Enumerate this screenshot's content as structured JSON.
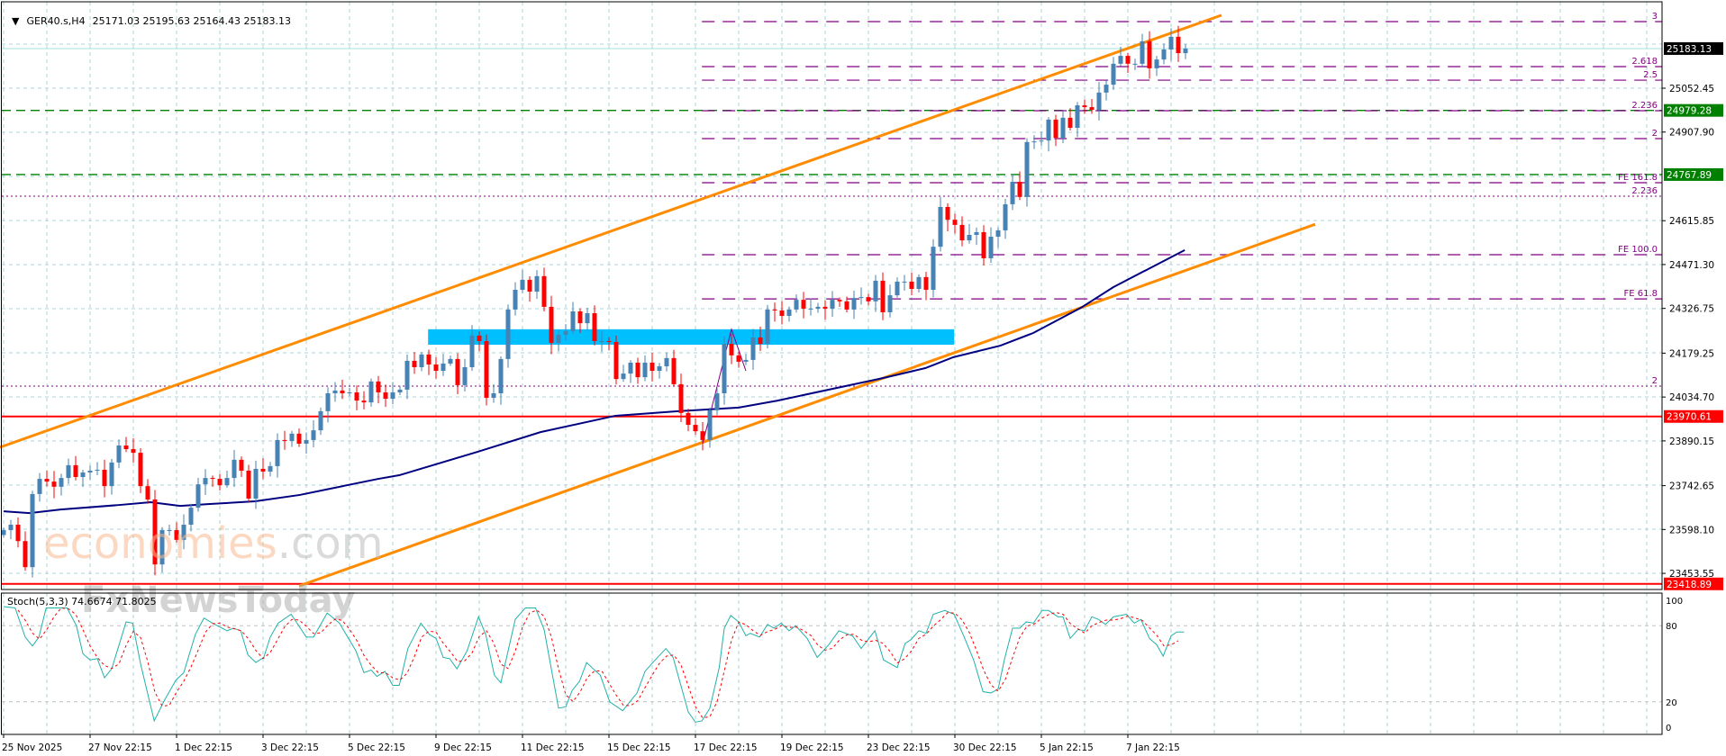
{
  "header": {
    "symbol": "GER40.s,H4",
    "ohlc": "25171.03 25195.63 25164.43 25183.13",
    "collapse_icon": "triangle-down-icon"
  },
  "colors": {
    "bull": "#4682b4",
    "bear": "#ff0000",
    "channel": "#ff8c00",
    "ma": "#000080",
    "zone": "#00bfff",
    "fib": "#800080",
    "support_green": "#008000",
    "support_red": "#ff0000",
    "grid": "#a8d4da",
    "stoch_k": "#20b2aa",
    "stoch_d": "#ff0000"
  },
  "watermark": {
    "brand1": "economies",
    "brand1_suffix": ".com",
    "brand2": "FxNewsToday"
  },
  "price_axis": {
    "ticks": [
      "25052.45",
      "24907.90",
      "24615.85",
      "24471.30",
      "24326.75",
      "24179.25",
      "24034.70",
      "23890.15",
      "23742.65",
      "23598.10",
      "23453.55"
    ],
    "markers": [
      {
        "value": "25183.13",
        "color": "#000000"
      },
      {
        "value": "24979.28",
        "color": "#008000"
      },
      {
        "value": "24767.89",
        "color": "#008000"
      },
      {
        "value": "23970.61",
        "color": "#ff0000"
      },
      {
        "value": "23418.89",
        "color": "#ff0000"
      }
    ]
  },
  "time_axis": {
    "labels": [
      {
        "i": 0,
        "text": "25 Nov 2025"
      },
      {
        "i": 12,
        "text": "27 Nov 22:15"
      },
      {
        "i": 24,
        "text": "1 Dec 22:15"
      },
      {
        "i": 36,
        "text": "3 Dec 22:15"
      },
      {
        "i": 48,
        "text": "5 Dec 22:15"
      },
      {
        "i": 60,
        "text": "9 Dec 22:15"
      },
      {
        "i": 72,
        "text": "11 Dec 22:15"
      },
      {
        "i": 84,
        "text": "15 Dec 22:15"
      },
      {
        "i": 96,
        "text": "17 Dec 22:15"
      },
      {
        "i": 108,
        "text": "19 Dec 22:15"
      },
      {
        "i": 120,
        "text": "23 Dec 22:15"
      },
      {
        "i": 132,
        "text": "30 Dec 22:15"
      },
      {
        "i": 144,
        "text": "5 Jan 22:15"
      },
      {
        "i": 156,
        "text": "7 Jan 22:15"
      }
    ]
  },
  "chart_data": {
    "type": "candlestick",
    "symbol": "GER40.s",
    "timeframe": "H4",
    "current_price": 25183.13,
    "closes": [
      23596,
      23614,
      23560,
      23474,
      23715,
      23765,
      23756,
      23739,
      23768,
      23810,
      23771,
      23786,
      23792,
      23795,
      23741,
      23819,
      23875,
      23863,
      23851,
      23741,
      23697,
      23483,
      23596,
      23596,
      23564,
      23614,
      23670,
      23747,
      23768,
      23765,
      23744,
      23768,
      23828,
      23792,
      23700,
      23798,
      23789,
      23807,
      23893,
      23890,
      23914,
      23881,
      23893,
      23925,
      23988,
      24047,
      24056,
      24047,
      24050,
      24023,
      24017,
      24086,
      24050,
      24029,
      24050,
      24059,
      24154,
      24133,
      24175,
      24142,
      24121,
      24145,
      24160,
      24074,
      24133,
      24237,
      24219,
      24032,
      24047,
      24160,
      24323,
      24388,
      24421,
      24382,
      24433,
      24332,
      24213,
      24240,
      24252,
      24317,
      24278,
      24311,
      24219,
      24219,
      24216,
      24094,
      24112,
      24148,
      24100,
      24148,
      24121,
      24136,
      24163,
      24077,
      23982,
      23943,
      23922,
      23893,
      23991,
      24047,
      24210,
      24172,
      24151,
      24157,
      24231,
      24210,
      24323,
      24320,
      24302,
      24323,
      24355,
      24326,
      24326,
      24332,
      24326,
      24355,
      24350,
      24323,
      24361,
      24364,
      24350,
      24418,
      24314,
      24370,
      24415,
      24415,
      24391,
      24430,
      24388,
      24530,
      24661,
      24619,
      24602,
      24551,
      24569,
      24578,
      24492,
      24563,
      24584,
      24670,
      24744,
      24694,
      24875,
      24877,
      24880,
      24949,
      24889,
      24955,
      24922,
      24996,
      24990,
      24981,
      25038,
      25064,
      25133,
      25159,
      25133,
      25133,
      25207,
      25118,
      25147,
      25180,
      25222,
      25168,
      25183
    ],
    "first_open": 23580,
    "moving_average": [
      [
        0,
        23658
      ],
      [
        3.6,
        23652
      ],
      [
        7.9,
        23664
      ],
      [
        16.1,
        23679
      ],
      [
        20.4,
        23688
      ],
      [
        24.5,
        23676
      ],
      [
        28.6,
        23682
      ],
      [
        34.9,
        23691
      ],
      [
        41.1,
        23712
      ],
      [
        45.4,
        23733
      ],
      [
        52,
        23765
      ],
      [
        54.9,
        23777
      ],
      [
        65.75,
        23854
      ],
      [
        74.5,
        23919
      ],
      [
        84.9,
        23973
      ],
      [
        93.6,
        23988
      ],
      [
        102,
        24000
      ],
      [
        107.4,
        24023
      ],
      [
        122,
        24097
      ],
      [
        127.9,
        24130
      ],
      [
        131.8,
        24166
      ],
      [
        138.3,
        24204
      ],
      [
        142.9,
        24246
      ],
      [
        149.5,
        24329
      ],
      [
        154,
        24397
      ],
      [
        163.9,
        24519
      ]
    ],
    "channel_upper": [
      [
        -0.5,
        23869
      ],
      [
        169,
        25293
      ]
    ],
    "channel_lower": [
      [
        41,
        23412
      ],
      [
        182,
        24604
      ]
    ],
    "zone": {
      "from_i": 58.9,
      "to_i": 131.9,
      "low": 24207,
      "high": 24258
    },
    "zigzag": [
      [
        97,
        23881
      ],
      [
        101,
        24258
      ],
      [
        103,
        24121
      ]
    ],
    "horizontal_levels": [
      {
        "price": 24979.28,
        "style": "dashed",
        "color": "#008000"
      },
      {
        "price": 24767.89,
        "style": "dashed",
        "color": "#008000"
      },
      {
        "price": 23970.61,
        "style": "solid",
        "color": "#ff0000"
      },
      {
        "price": 23418.89,
        "style": "solid",
        "color": "#ff0000"
      }
    ],
    "fib_start_i": 96.9,
    "fib_levels": [
      {
        "label": "3",
        "price": 25271.9
      },
      {
        "label": "2.618",
        "price": 25123.6
      },
      {
        "label": "2.5",
        "price": 25079.0
      },
      {
        "label": "2.236",
        "price": 24978.3
      },
      {
        "label": "2",
        "price": 24886.3
      },
      {
        "label": "FE 161.8",
        "price": 24741.0
      },
      {
        "label": "FE 100.0",
        "price": 24503.7
      },
      {
        "label": "FE 61.8",
        "price": 24358.0
      }
    ],
    "fib_full_levels": [
      {
        "label": "2.236",
        "price": 24696.5
      },
      {
        "label": "2",
        "price": 24070.7
      }
    ],
    "stochastic": {
      "label": "Stoch(5,3,3) 74.6674 71.8025",
      "levels": [
        "100",
        "80",
        "20",
        "0"
      ],
      "k": [
        [
          0,
          95
        ],
        [
          1.6,
          94
        ],
        [
          3,
          71
        ],
        [
          4,
          64
        ],
        [
          4.9,
          71
        ],
        [
          5.9,
          94
        ],
        [
          8.8,
          94
        ],
        [
          10.1,
          80
        ],
        [
          11,
          58
        ],
        [
          12,
          53
        ],
        [
          13,
          54
        ],
        [
          14,
          39
        ],
        [
          15,
          46
        ],
        [
          17,
          83
        ],
        [
          17.9,
          82
        ],
        [
          19,
          50
        ],
        [
          20.9,
          5
        ],
        [
          22.3,
          21
        ],
        [
          23.9,
          37
        ],
        [
          25,
          43
        ],
        [
          26.6,
          73
        ],
        [
          27.8,
          86
        ],
        [
          29,
          82
        ],
        [
          31,
          76
        ],
        [
          31.9,
          78
        ],
        [
          32.9,
          76
        ],
        [
          33.9,
          57
        ],
        [
          35,
          51
        ],
        [
          36.1,
          55
        ],
        [
          37,
          71
        ],
        [
          38.1,
          82
        ],
        [
          39.9,
          89
        ],
        [
          42,
          71
        ],
        [
          43,
          71
        ],
        [
          44.9,
          90
        ],
        [
          46.6,
          82
        ],
        [
          48.9,
          60
        ],
        [
          50,
          43
        ],
        [
          51,
          45
        ],
        [
          51.8,
          40
        ],
        [
          52.9,
          44
        ],
        [
          54,
          33
        ],
        [
          54.9,
          33
        ],
        [
          56.1,
          62
        ],
        [
          57.9,
          82
        ],
        [
          59.1,
          73
        ],
        [
          60,
          70
        ],
        [
          61,
          55
        ],
        [
          61.9,
          54
        ],
        [
          62.9,
          46
        ],
        [
          64.3,
          60
        ],
        [
          65.9,
          87
        ],
        [
          66.9,
          73
        ],
        [
          68.1,
          41
        ],
        [
          69,
          35
        ],
        [
          71,
          85
        ],
        [
          72.4,
          94
        ],
        [
          73.8,
          94
        ],
        [
          75,
          77
        ],
        [
          77,
          15
        ],
        [
          78,
          16
        ],
        [
          78.9,
          29
        ],
        [
          79.9,
          36
        ],
        [
          80.9,
          51
        ],
        [
          82,
          45
        ],
        [
          82.8,
          41
        ],
        [
          84.1,
          20
        ],
        [
          85.9,
          13
        ],
        [
          87.9,
          27
        ],
        [
          89,
          44
        ],
        [
          90.1,
          51
        ],
        [
          91.9,
          62
        ],
        [
          92.9,
          55
        ],
        [
          95,
          12
        ],
        [
          96,
          4
        ],
        [
          96.9,
          5
        ],
        [
          98,
          15
        ],
        [
          99.3,
          47
        ],
        [
          100,
          78
        ],
        [
          100.9,
          88
        ],
        [
          102,
          83
        ],
        [
          103,
          72
        ],
        [
          103.6,
          74
        ],
        [
          104.9,
          71
        ],
        [
          106,
          81
        ],
        [
          106.9,
          78
        ],
        [
          107.9,
          82
        ],
        [
          109,
          76
        ],
        [
          109.9,
          80
        ],
        [
          111.5,
          70
        ],
        [
          112.9,
          55
        ],
        [
          114.5,
          65
        ],
        [
          115.9,
          76
        ],
        [
          117.8,
          72
        ],
        [
          119,
          62
        ],
        [
          120.9,
          76
        ],
        [
          122.1,
          53
        ],
        [
          124,
          47
        ],
        [
          125.1,
          66
        ],
        [
          125.9,
          69
        ],
        [
          127,
          76
        ],
        [
          128,
          74
        ],
        [
          129,
          89
        ],
        [
          130.6,
          92
        ],
        [
          131.9,
          89
        ],
        [
          133.3,
          71
        ],
        [
          134.6,
          53
        ],
        [
          135.9,
          28
        ],
        [
          137,
          27
        ],
        [
          138,
          30
        ],
        [
          138.9,
          54
        ],
        [
          140,
          78
        ],
        [
          141,
          78
        ],
        [
          141.9,
          83
        ],
        [
          142.9,
          82
        ],
        [
          144.1,
          92
        ],
        [
          145,
          92
        ],
        [
          146.3,
          87
        ],
        [
          147,
          87
        ],
        [
          148,
          70
        ],
        [
          149.1,
          77
        ],
        [
          150,
          76
        ],
        [
          151,
          87
        ],
        [
          151.9,
          85
        ],
        [
          152.9,
          81
        ],
        [
          154,
          87
        ],
        [
          155.8,
          89
        ],
        [
          156.9,
          82
        ],
        [
          157.8,
          85
        ],
        [
          159,
          70
        ],
        [
          160,
          65
        ],
        [
          160.9,
          56
        ],
        [
          162,
          72
        ],
        [
          162.8,
          75
        ],
        [
          163.8,
          75
        ]
      ]
    }
  }
}
